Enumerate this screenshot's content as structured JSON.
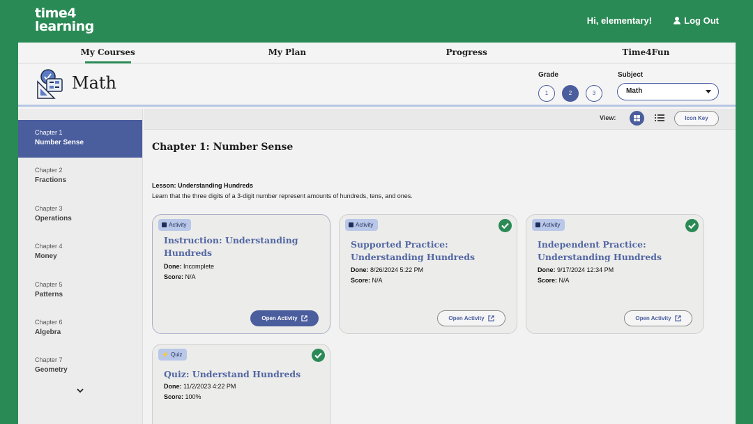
{
  "header": {
    "logo_line1": "time4",
    "logo_line2": "learning",
    "greeting": "Hi, elementary!",
    "logout_label": "Log Out"
  },
  "nav": [
    {
      "label": "My Courses",
      "active": true
    },
    {
      "label": "My Plan"
    },
    {
      "label": "Progress"
    },
    {
      "label": "Time4Fun"
    }
  ],
  "subject_bar": {
    "title": "Math",
    "grade_label": "Grade",
    "grades": [
      "1",
      "2",
      "3"
    ],
    "selected_grade": "2",
    "subject_label": "Subject",
    "subject_value": "Math"
  },
  "sidebar": {
    "chapters": [
      {
        "chapter": "Chapter 1",
        "name": "Number Sense",
        "active": true
      },
      {
        "chapter": "Chapter 2",
        "name": "Fractions"
      },
      {
        "chapter": "Chapter 3",
        "name": "Operations"
      },
      {
        "chapter": "Chapter 4",
        "name": "Money"
      },
      {
        "chapter": "Chapter 5",
        "name": "Patterns"
      },
      {
        "chapter": "Chapter 6",
        "name": "Algebra"
      },
      {
        "chapter": "Chapter 7",
        "name": "Geometry"
      }
    ]
  },
  "viewbar": {
    "view_label": "View:",
    "icon_key_label": "Icon Key"
  },
  "content": {
    "chapter_title": "Chapter 1: Number Sense",
    "lesson_name": "Lesson: Understanding Hundreds",
    "lesson_description": "Learn that the three digits of a 3-digit number represent amounts of hundreds, tens, and ones.",
    "cards": [
      {
        "badge": "Activity",
        "title": "Instruction: Understanding Hundreds",
        "done_label": "Done:",
        "done": "Incomplete",
        "score_label": "Score:",
        "score": "N/A",
        "button": "Open Activity",
        "completed": false
      },
      {
        "badge": "Activity",
        "title": "Supported Practice: Understanding Hundreds",
        "done_label": "Done:",
        "done": "8/26/2024 5:22 PM",
        "score_label": "Score:",
        "score": "N/A",
        "button": "Open Activity",
        "completed": true
      },
      {
        "badge": "Activity",
        "title": "Independent Practice: Understanding Hundreds",
        "done_label": "Done:",
        "done": "9/17/2024 12:34 PM",
        "score_label": "Score:",
        "score": "N/A",
        "button": "Open Activity",
        "completed": true
      },
      {
        "badge": "Quiz",
        "title": "Quiz: Understand Hundreds",
        "done_label": "Done:",
        "done": "11/2/2023 4:22 PM",
        "score_label": "Score:",
        "score": "100%",
        "completed": true
      }
    ]
  },
  "colors": {
    "brand_green": "#2a8a55",
    "accent_blue": "#4a5d9d",
    "title_blue": "#5367a3"
  }
}
